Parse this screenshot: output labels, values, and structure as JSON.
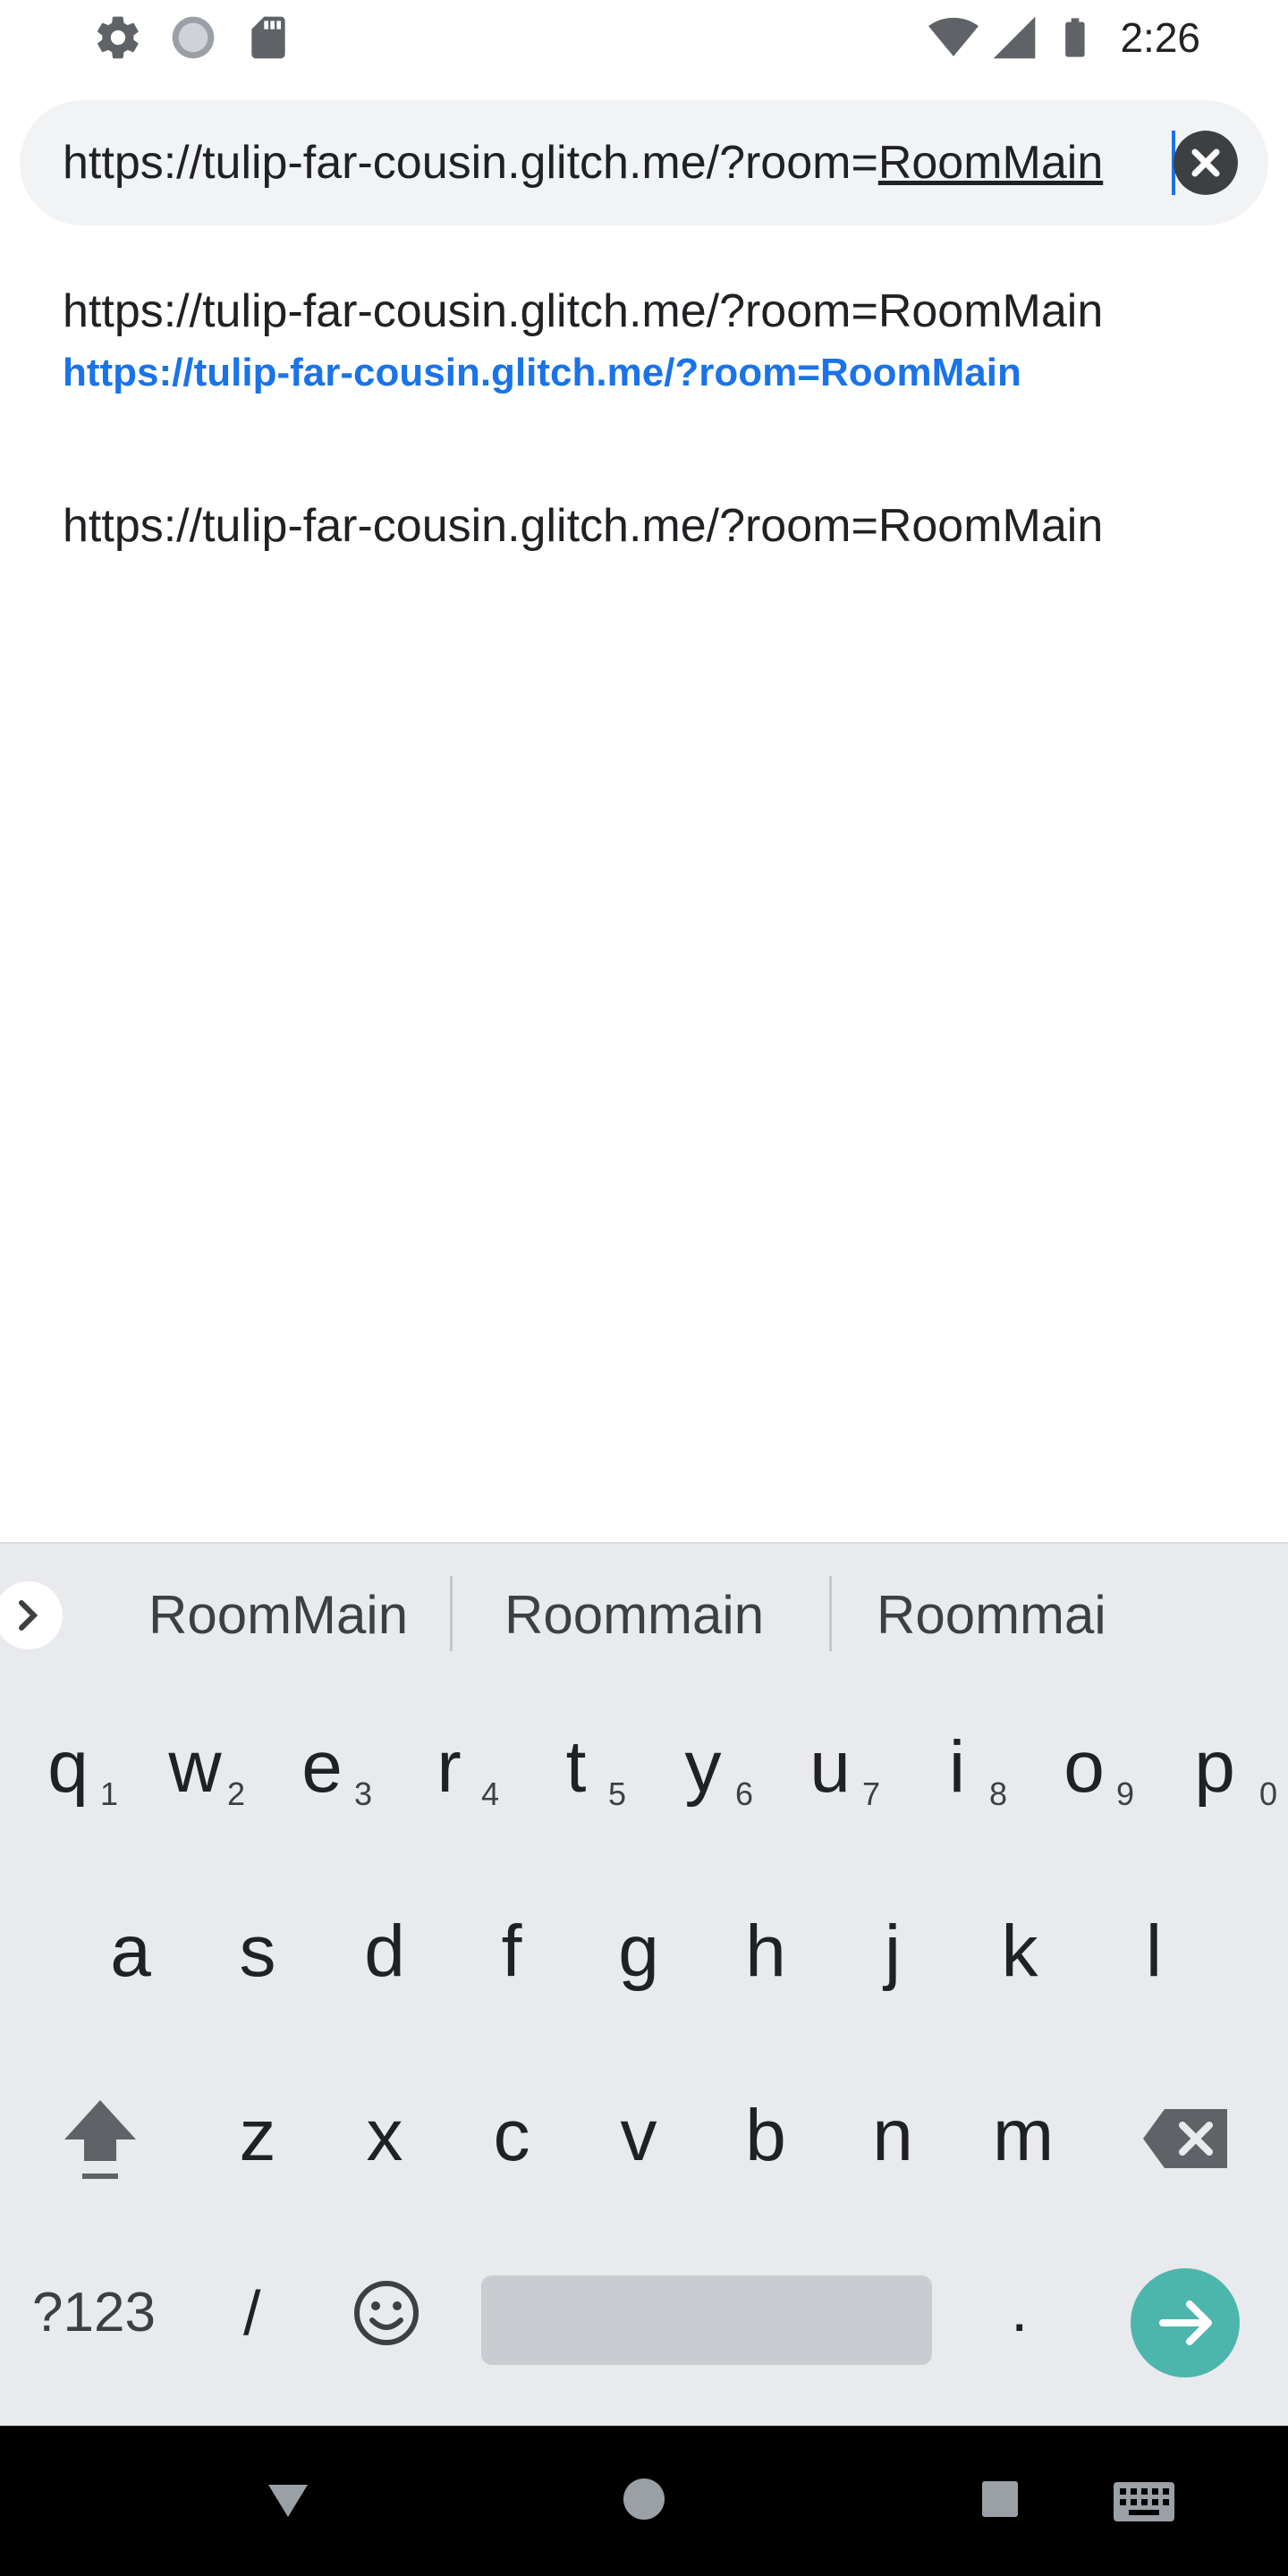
{
  "status_bar": {
    "time": "2:26",
    "left_icons": [
      "settings-icon",
      "loading-icon",
      "sd-card-icon"
    ],
    "right_icons": [
      "wifi-icon",
      "signal-icon",
      "battery-icon"
    ]
  },
  "omnibox": {
    "url_prefix": "https://tulip-far-cousin.glitch.me/?room=",
    "url_highlight": "RoomMain",
    "clear_icon": "close-circle-icon"
  },
  "suggestions": [
    {
      "title": "https://tulip-far-cousin.glitch.me/?room=RoomMain",
      "url": "https://tulip-far-cousin.glitch.me/?room=RoomMain"
    },
    {
      "title": "https://tulip-far-cousin.glitch.me/?room=RoomMain"
    }
  ],
  "keyboard": {
    "word_suggestions": [
      "RoomMain",
      "Roommain",
      "Roommai"
    ],
    "row1": [
      "q",
      "w",
      "e",
      "r",
      "t",
      "y",
      "u",
      "i",
      "o",
      "p"
    ],
    "row1_hints": [
      "1",
      "2",
      "3",
      "4",
      "5",
      "6",
      "7",
      "8",
      "9",
      "0"
    ],
    "row2": [
      "a",
      "s",
      "d",
      "f",
      "g",
      "h",
      "j",
      "k",
      "l"
    ],
    "row3": [
      "z",
      "x",
      "c",
      "v",
      "b",
      "n",
      "m"
    ],
    "symbols_label": "?123",
    "slash_label": "/",
    "period_label": ".",
    "enter_color": "#4db6ac"
  },
  "nav_bar": {
    "icons": [
      "back-icon",
      "home-icon",
      "recents-icon",
      "keyboard-icon"
    ]
  }
}
